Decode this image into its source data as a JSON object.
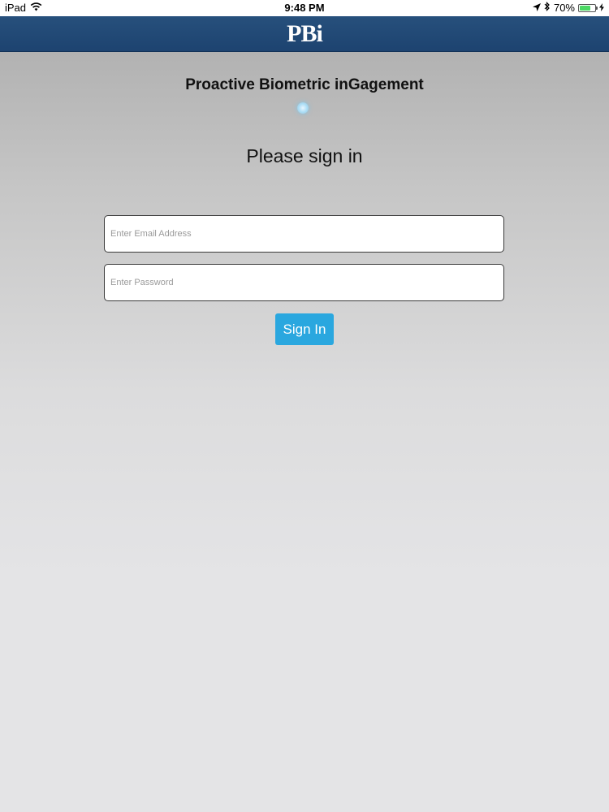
{
  "status_bar": {
    "device": "iPad",
    "time": "9:48 PM",
    "battery_percent": "70%",
    "battery_level": 0.7,
    "icons": [
      "wifi-icon",
      "location-arrow-icon",
      "bluetooth-icon",
      "battery-icon",
      "charging-bolt-icon"
    ]
  },
  "header": {
    "logo_text": "PBi",
    "background_color": "#1f4673"
  },
  "main": {
    "app_title": "Proactive Biometric inGagement",
    "heading": "Please sign in",
    "email": {
      "value": "",
      "placeholder": "Enter Email Address"
    },
    "password": {
      "value": "",
      "placeholder": "Enter Password"
    },
    "sign_in_label": "Sign In",
    "button_color": "#2aa7df"
  }
}
